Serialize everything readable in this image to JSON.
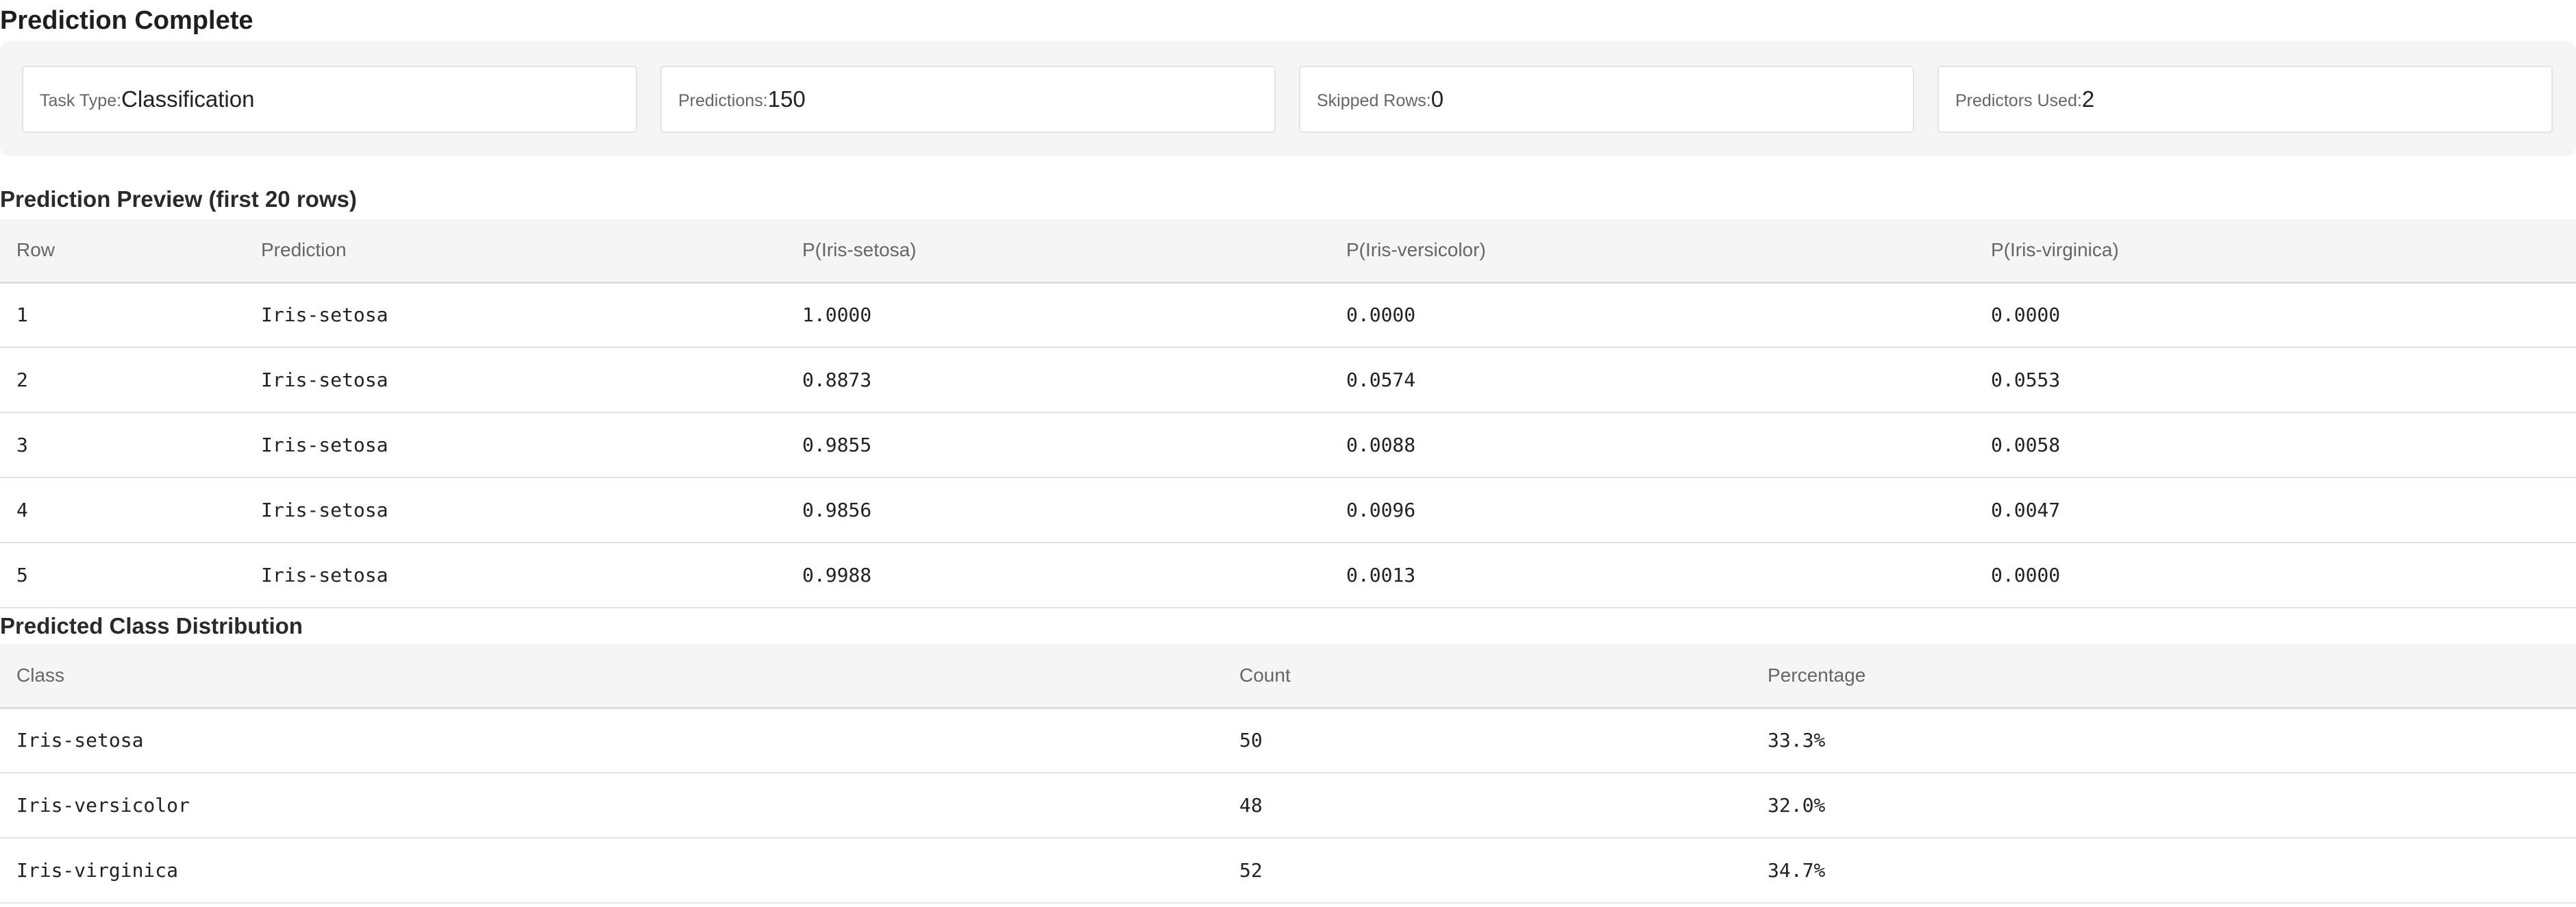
{
  "page_title": "Prediction Complete",
  "summary": {
    "task_type": {
      "label": "Task Type:",
      "value": "Classification"
    },
    "predictions": {
      "label": "Predictions:",
      "value": "150"
    },
    "skipped_rows": {
      "label": "Skipped Rows:",
      "value": "0"
    },
    "predictors_used": {
      "label": "Predictors Used:",
      "value": "2"
    }
  },
  "preview": {
    "title": "Prediction Preview (first 20 rows)",
    "columns": [
      "Row",
      "Prediction",
      "P(Iris-setosa)",
      "P(Iris-versicolor)",
      "P(Iris-virginica)"
    ],
    "rows": [
      [
        "1",
        "Iris-setosa",
        "1.0000",
        "0.0000",
        "0.0000"
      ],
      [
        "2",
        "Iris-setosa",
        "0.8873",
        "0.0574",
        "0.0553"
      ],
      [
        "3",
        "Iris-setosa",
        "0.9855",
        "0.0088",
        "0.0058"
      ],
      [
        "4",
        "Iris-setosa",
        "0.9856",
        "0.0096",
        "0.0047"
      ],
      [
        "5",
        "Iris-setosa",
        "0.9988",
        "0.0013",
        "0.0000"
      ]
    ]
  },
  "distribution": {
    "title": "Predicted Class Distribution",
    "columns": [
      "Class",
      "Count",
      "Percentage"
    ],
    "rows": [
      [
        "Iris-setosa",
        "50",
        "33.3%"
      ],
      [
        "Iris-versicolor",
        "48",
        "32.0%"
      ],
      [
        "Iris-virginica",
        "52",
        "34.7%"
      ]
    ]
  }
}
